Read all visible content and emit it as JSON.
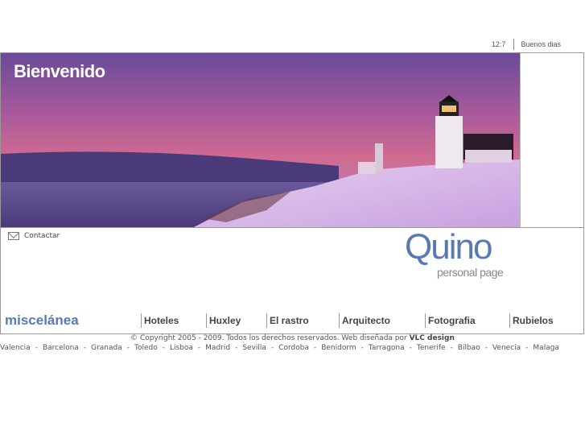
{
  "topbar": {
    "time": "12:7",
    "greeting": "Buenos dias"
  },
  "hero": {
    "title": "Bienvenido"
  },
  "contact": {
    "label": "Contactar",
    "icon": "mail-icon"
  },
  "logo": {
    "name": "Quino",
    "subtitle": "personal page"
  },
  "nav": {
    "section": "miscelánea",
    "items": [
      "Hoteles",
      "Huxley",
      "El rastro",
      "Arquitecto",
      "Fotografia",
      "Rubielos"
    ]
  },
  "footer": {
    "copyright": "© Copyright 2005 - 2009. Todos los derechos reservados. Web diseñada por ",
    "designer": "VLC design",
    "cities": [
      "Valencia",
      "Barcelona",
      "Granada",
      "Toledo",
      "Lisboa",
      "Madrid",
      "Sevilla",
      "Cordoba",
      "Benidorm",
      "Tarragona",
      "Tenerife",
      "Bilbao",
      "Venecia",
      "Malaga"
    ]
  }
}
